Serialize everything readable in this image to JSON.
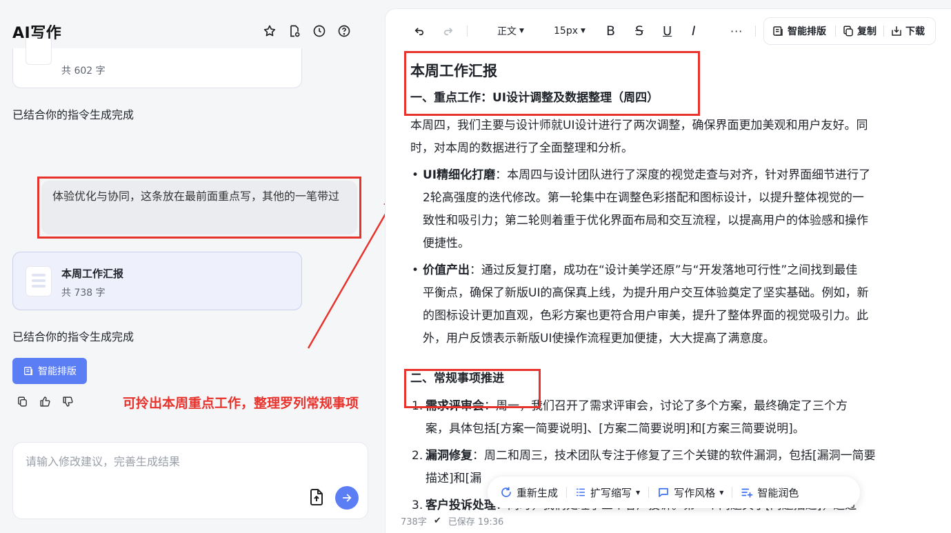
{
  "app": {
    "title": "AI写作"
  },
  "header_icons": [
    "star-icon",
    "document-settings-icon",
    "history-clock-icon",
    "help-icon"
  ],
  "history": {
    "prev_doc": {
      "count": "共 602 字"
    },
    "status1": "已结合你的指令生成完成",
    "user_message": "体验优化与协同，这条放在最前面重点写，其他的一笔带过",
    "current_doc": {
      "name": "本周工作汇报",
      "count": "共 738 字"
    },
    "status2": "已结合你的指令生成完成",
    "smart_layout_button": "智能排版"
  },
  "annotation": "可拎出本周重点工作，整理罗列常规事项",
  "input": {
    "placeholder": "请输入修改建议，完善生成结果"
  },
  "toolbar": {
    "style": "正文",
    "font_size": "15px",
    "smart_layout": "智能排版",
    "copy": "复制",
    "download": "下载"
  },
  "document": {
    "title": "本周工作汇报",
    "section1_heading": "一、重点工作：UI设计调整及数据整理（周四）",
    "intro_line1": "本周四，我们主要与设计师就UI设计进行了两次调整，确保界面更加美观和用户友好。同",
    "intro_line2": "时，对本周的数据进行了全面整理和分析。",
    "bullet1": {
      "label": "UI精细化打磨",
      "lines": [
        "：本周四与设计团队进行了深度的视觉走查与对齐，针对界面细节进行了",
        "2轮高强度的迭代修改。第一轮集中在调整色彩搭配和图标设计，以提升整体视觉的一",
        "致性和吸引力；第二轮则着重于优化界面布局和交互流程，以提高用户的体验感和操作",
        "便捷性。"
      ]
    },
    "bullet2": {
      "label": "价值产出",
      "lines": [
        "：通过反复打磨，成功在“设计美学还原”与“开发落地可行性”之间找到最佳",
        "平衡点，确保了新版UI的高保真上线，为提升用户交互体验奠定了坚实基础。例如，新",
        "的图标设计更加直观，色彩方案也更符合用户审美，提升了整体界面的视觉吸引力。此",
        "外，用户反馈表示新版UI使操作流程更加便捷，大大提高了满意度。"
      ]
    },
    "section2_heading": "二、常规事项推进",
    "item1": {
      "num": "1.",
      "label": "需求评审会",
      "lines": [
        "：周一，我们召开了需求评审会，讨论了多个方案，最终确定了三个方",
        "案，具体包括[方案一简要说明]、[方案二简要说明]和[方案三简要说明]。"
      ]
    },
    "item2": {
      "num": "2.",
      "label": "漏洞修复",
      "line1_visible": "：周二和周三，技术团队专注于修复了三个关键的软件漏洞，包括[漏洞一简要",
      "line2_visible": "描述]和[漏"
    },
    "item3": {
      "num": "3.",
      "label": "客户投诉处理",
      "line1_visible": "：同时，我们处理了三个客户投诉。第一个问题关于[问题描述]，通过"
    }
  },
  "float_bar": {
    "regenerate": "重新生成",
    "expand_shrink": "扩写缩写",
    "writing_style": "写作风格",
    "polish": "智能润色"
  },
  "footer": {
    "word_count": "738字",
    "saved": "已保存 19:36"
  },
  "colors": {
    "accent": "#5b7ef5",
    "annotation_red": "#e8322c"
  }
}
